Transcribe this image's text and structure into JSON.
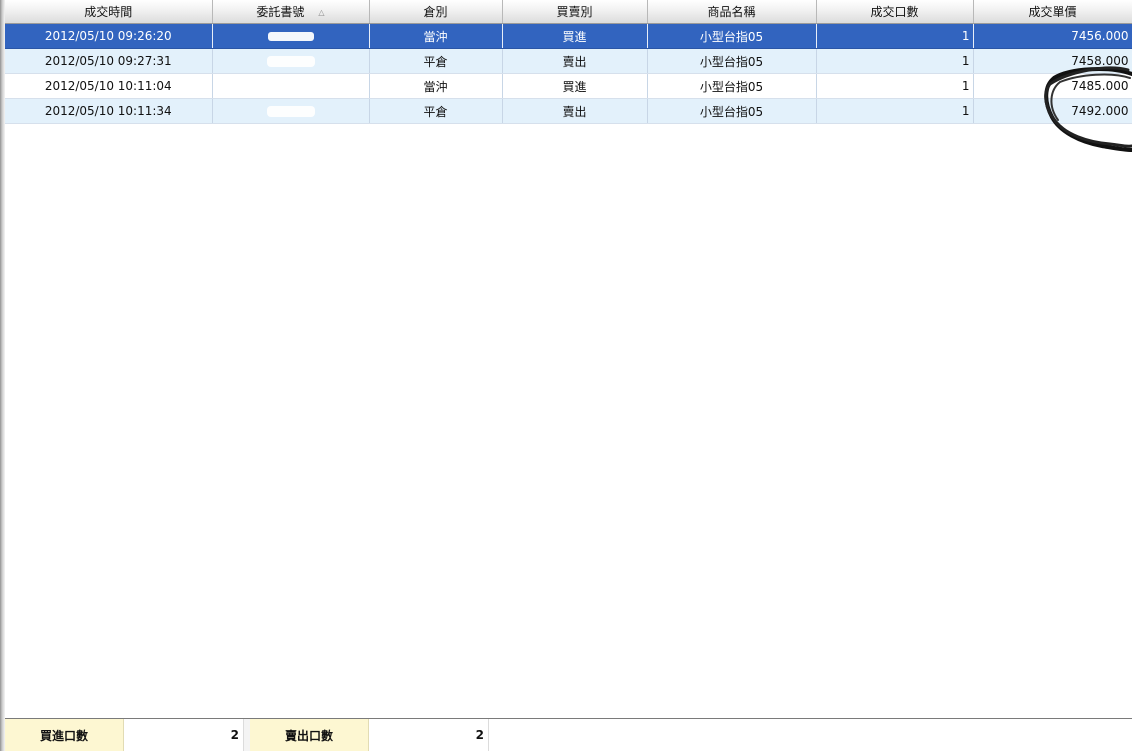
{
  "columns": [
    {
      "label": "成交時間"
    },
    {
      "label": "委託書號"
    },
    {
      "label": "倉別"
    },
    {
      "label": "買賣別"
    },
    {
      "label": "商品名稱"
    },
    {
      "label": "成交口數"
    },
    {
      "label": "成交單價"
    }
  ],
  "sort_indicator": "△",
  "rows": [
    {
      "time": "2012/05/10 09:26:20",
      "order_no": "",
      "position": "當沖",
      "side": "買進",
      "product": "小型台指05",
      "qty": "1",
      "price": "7456.000"
    },
    {
      "time": "2012/05/10 09:27:31",
      "order_no": "",
      "position": "平倉",
      "side": "賣出",
      "product": "小型台指05",
      "qty": "1",
      "price": "7458.000"
    },
    {
      "time": "2012/05/10 10:11:04",
      "order_no": "",
      "position": "當沖",
      "side": "買進",
      "product": "小型台指05",
      "qty": "1",
      "price": "7485.000"
    },
    {
      "time": "2012/05/10 10:11:34",
      "order_no": "",
      "position": "平倉",
      "side": "賣出",
      "product": "小型台指05",
      "qty": "1",
      "price": "7492.000"
    }
  ],
  "summary": {
    "buy_label": "買進口數",
    "buy_value": "2",
    "sell_label": "賣出口數",
    "sell_value": "2"
  },
  "colors": {
    "selected_row": "#3264bf",
    "alt_row": "#e3f1fb",
    "buy": "#c2141c",
    "sell": "#128a12",
    "summary_label_bg": "#fdf7d2"
  }
}
